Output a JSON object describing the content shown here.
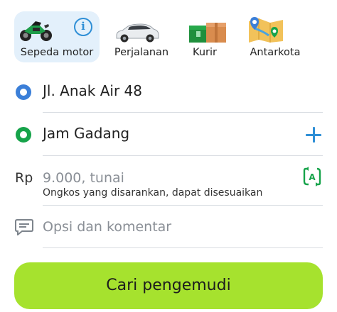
{
  "services": [
    {
      "label": "Sepeda motor",
      "icon": "motorcycle-icon"
    },
    {
      "label": "Perjalanan",
      "icon": "car-icon"
    },
    {
      "label": "Kurir",
      "icon": "parcel-icon"
    },
    {
      "label": "Antarkota",
      "icon": "map-icon"
    }
  ],
  "route": {
    "pickup": "Jl. Anak Air 48",
    "destination": "Jam Gadang"
  },
  "fare": {
    "currency": "Rp",
    "value": "9.000, tunai",
    "hint": "Ongkos yang disarankan, dapat disesuaikan"
  },
  "options": {
    "placeholder": "Opsi dan komentar"
  },
  "action": {
    "label": "Cari pengemudi"
  },
  "colors": {
    "accent_blue": "#2f8fd6",
    "pickup_blue": "#3b7fd8",
    "destination_green": "#16a34a",
    "cta_lime": "#a6e22e",
    "selected_tab_bg": "#e3f0fb"
  }
}
